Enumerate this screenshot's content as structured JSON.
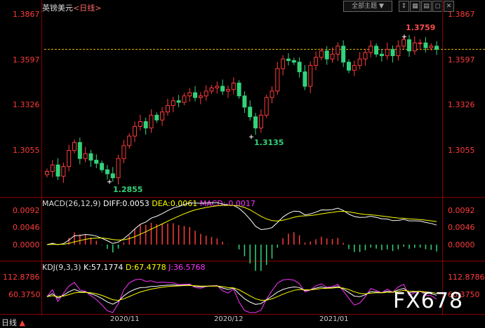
{
  "header": {
    "symbol": "英镑美元",
    "period": "<日线>",
    "theme_button": "全部主题",
    "theme_arrow": "▼"
  },
  "toolbar": {
    "icons": [
      "arrow-up-down-icon",
      "grid-icon",
      "settings-icon",
      "window-icon",
      "close-icon"
    ]
  },
  "price_pane": {
    "y_labels": [
      "1.3867",
      "1.3597",
      "1.3326",
      "1.3055"
    ],
    "annotations": [
      {
        "text": "1.3759",
        "color": "#ff4d4d"
      },
      {
        "text": "1.3135",
        "color": "#33d37a"
      },
      {
        "text": "1.2855",
        "color": "#33d37a"
      }
    ]
  },
  "macd_pane": {
    "title": "MACD(26,12,9)",
    "diff_label": "DIFF:0.0053",
    "dea_label": "DEA:0.0061",
    "macd_label": "MACD:-0.0017",
    "y_labels": [
      "0.0092",
      "0.0046",
      "0.0000"
    ]
  },
  "kdj_pane": {
    "title": "KDJ(9,3,3)",
    "k_label": "K:57.1774",
    "d_label": "D:67.4778",
    "j_label": "J:36.5768",
    "y_labels": [
      "112.8786",
      "60.3750"
    ]
  },
  "bottom": {
    "period_tab": "日线",
    "tab_arrow": "▲",
    "dates": [
      "2020/11",
      "2020/12",
      "2021/01"
    ]
  },
  "watermark": "FX678",
  "colors": {
    "up": "#ff3b3b",
    "down": "#33d37a",
    "grid": "#8a0000",
    "dashed_ref": "#e8b800",
    "diff_line": "#ffffff",
    "dea_line": "#ffff00",
    "j_line": "#ff33ff"
  },
  "chart_data": {
    "type": "line",
    "instrument": "英镑美元",
    "period": "日线",
    "x": [
      "2020/11",
      "2020/12",
      "2021/01"
    ],
    "price_axis": {
      "ticks": [
        1.3867,
        1.3597,
        1.3326,
        1.3055
      ],
      "ylim": [
        1.28,
        1.39
      ]
    },
    "close_series": [
      1.292,
      1.296,
      1.289,
      1.295,
      1.305,
      1.31,
      1.3,
      1.303,
      1.299,
      1.297,
      1.293,
      1.2905,
      1.288,
      1.3,
      1.308,
      1.314,
      1.32,
      1.323,
      1.319,
      1.327,
      1.324,
      1.329,
      1.333,
      1.336,
      1.335,
      1.339,
      1.341,
      1.338,
      1.339,
      1.342,
      1.344,
      1.345,
      1.342,
      1.343,
      1.347,
      1.339,
      1.332,
      1.326,
      1.319,
      1.327,
      1.338,
      1.342,
      1.356,
      1.362,
      1.361,
      1.36,
      1.354,
      1.345,
      1.358,
      1.363,
      1.367,
      1.362,
      1.365,
      1.37,
      1.36,
      1.355,
      1.358,
      1.362,
      1.366,
      1.37,
      1.365,
      1.364,
      1.368,
      1.364,
      1.37,
      1.374,
      1.367,
      1.372,
      1.372,
      1.369,
      1.37,
      1.368
    ],
    "annotations": [
      {
        "label": "1.3759",
        "value": 1.3759,
        "type": "high"
      },
      {
        "label": "1.3135",
        "value": 1.3135,
        "type": "low"
      },
      {
        "label": "1.2855",
        "value": 1.2855,
        "type": "low"
      }
    ],
    "macd": {
      "params": "26,12,9",
      "diff": 0.0053,
      "dea": 0.0061,
      "macd": -0.0017,
      "ticks": [
        0.0092,
        0.0046,
        0.0
      ]
    },
    "kdj": {
      "params": "9,3,3",
      "k": 57.1774,
      "d": 67.4778,
      "j": 36.5768,
      "ticks": [
        112.8786,
        60.375
      ]
    }
  }
}
